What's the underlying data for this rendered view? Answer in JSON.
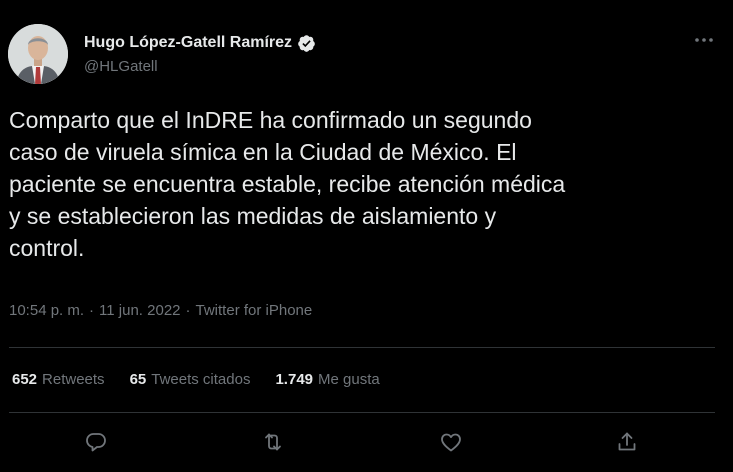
{
  "author": {
    "display_name": "Hugo López-Gatell Ramírez",
    "handle": "@HLGatell",
    "verified": true,
    "avatar_icon": "profile-photo"
  },
  "tweet": {
    "text_lines": [
      "Comparto que el InDRE ha confirmado un segundo",
      "caso de viruela símica en la Ciudad de México. El",
      "paciente se encuentra estable, recibe atención médica",
      "y se establecieron las medidas de aislamiento y",
      "control."
    ],
    "time": "10:54 p. m.",
    "date": "11 jun. 2022",
    "source": "Twitter for iPhone",
    "separator": "·"
  },
  "stats": {
    "retweets_count": "652",
    "retweets_label": "Retweets",
    "quotes_count": "65",
    "quotes_label": "Tweets citados",
    "likes_count": "1.749",
    "likes_label": "Me gusta"
  },
  "actions": [
    "reply-icon",
    "retweet-icon",
    "like-icon",
    "share-icon"
  ],
  "colors": {
    "background": "#000000",
    "text": "#e7e9ea",
    "secondary": "#71767b",
    "divider": "#2f3336"
  }
}
